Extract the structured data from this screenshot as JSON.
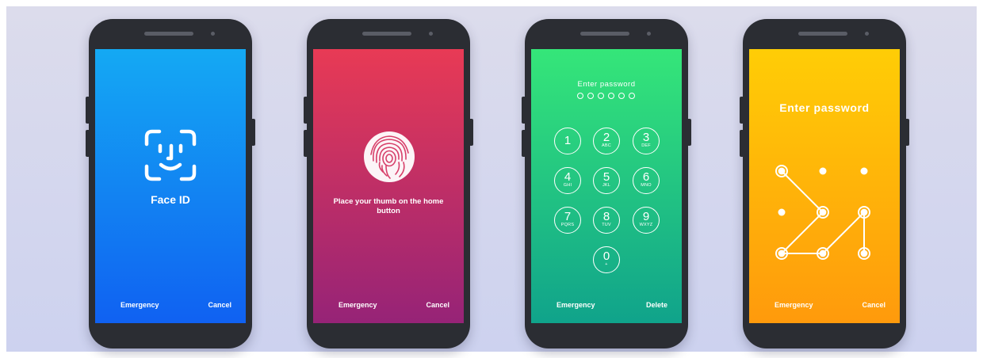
{
  "phones": [
    {
      "screen": "face-id",
      "title": "Face ID",
      "bottom_left": "Emergency",
      "bottom_right": "Cancel",
      "icon": "face-id-icon"
    },
    {
      "screen": "fingerprint",
      "instruction": "Place your thumb on the home button",
      "bottom_left": "Emergency",
      "bottom_right": "Cancel",
      "icon": "fingerprint-icon"
    },
    {
      "screen": "passcode",
      "title": "Enter password",
      "bottom_left": "Emergency",
      "bottom_right": "Delete",
      "keys": [
        {
          "digit": "1",
          "letters": ""
        },
        {
          "digit": "2",
          "letters": "ABC"
        },
        {
          "digit": "3",
          "letters": "DEF"
        },
        {
          "digit": "4",
          "letters": "GHI"
        },
        {
          "digit": "5",
          "letters": "JKL"
        },
        {
          "digit": "6",
          "letters": "MNO"
        },
        {
          "digit": "7",
          "letters": "PQRS"
        },
        {
          "digit": "8",
          "letters": "TUV"
        },
        {
          "digit": "9",
          "letters": "WXYZ"
        },
        {
          "digit": "0",
          "letters": "+"
        }
      ],
      "passcode_length": 6
    },
    {
      "screen": "pattern",
      "title": "Enter password",
      "bottom_left": "Emergency",
      "bottom_right": "Cancel"
    }
  ],
  "colors": {
    "face_id_gradient": [
      "#14a9f3",
      "#1061f2"
    ],
    "fingerprint_gradient": [
      "#e83a55",
      "#962377"
    ],
    "passcode_gradient": [
      "#35e679",
      "#10a38b"
    ],
    "pattern_gradient": [
      "#ffcd06",
      "#ff9a0c"
    ],
    "phone_body": "#2b2d33"
  }
}
